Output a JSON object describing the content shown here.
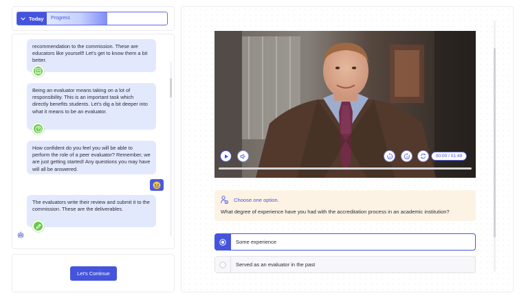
{
  "header": {
    "today_label": "Today",
    "progress_label": "Progress",
    "progress_fraction": 0.5
  },
  "chat": {
    "messages": [
      {
        "text": "recommendation to the commission. These are educators like yourself! Let's get to know them a bit better.",
        "badge_icon": "people-icon"
      },
      {
        "text": "Being an evaluator means taking on a lot of responsibility. This is an important task which directly benefits students. Let's dig a bit deeper into what it means to be an evaluator.",
        "badge_icon": "question-icon"
      },
      {
        "text": "How confident do you feel you will be able to perform the role of a peer evaluator? Remember, we are just getting started! Any questions you may have will all be answered.",
        "badge_icon": ""
      },
      {
        "text": "The evaluators write their review and submit it to the commission. These are the deliverables.",
        "badge_icon": "pencil-icon"
      }
    ],
    "user_reply_icon": "grimacing-emoji-icon"
  },
  "footer": {
    "continue_label": "Let's Continue"
  },
  "video": {
    "time_display": "00:00 / 01:49",
    "controls": [
      "play-icon",
      "volume-icon",
      "rewind-10-icon",
      "forward-10-icon",
      "replay-icon"
    ]
  },
  "question": {
    "instruction": "Choose one option.",
    "text": "What degree of experience have you had with the accreditation process in an academic institution?",
    "options": [
      {
        "label": "Some experience",
        "selected": true
      },
      {
        "label": "Served as an evaluator in the past",
        "selected": false
      }
    ]
  },
  "colors": {
    "accent": "#4554dc",
    "bubble": "#e3e9fd",
    "badge": "#68c84a",
    "question_bg": "#fdf3e5"
  }
}
